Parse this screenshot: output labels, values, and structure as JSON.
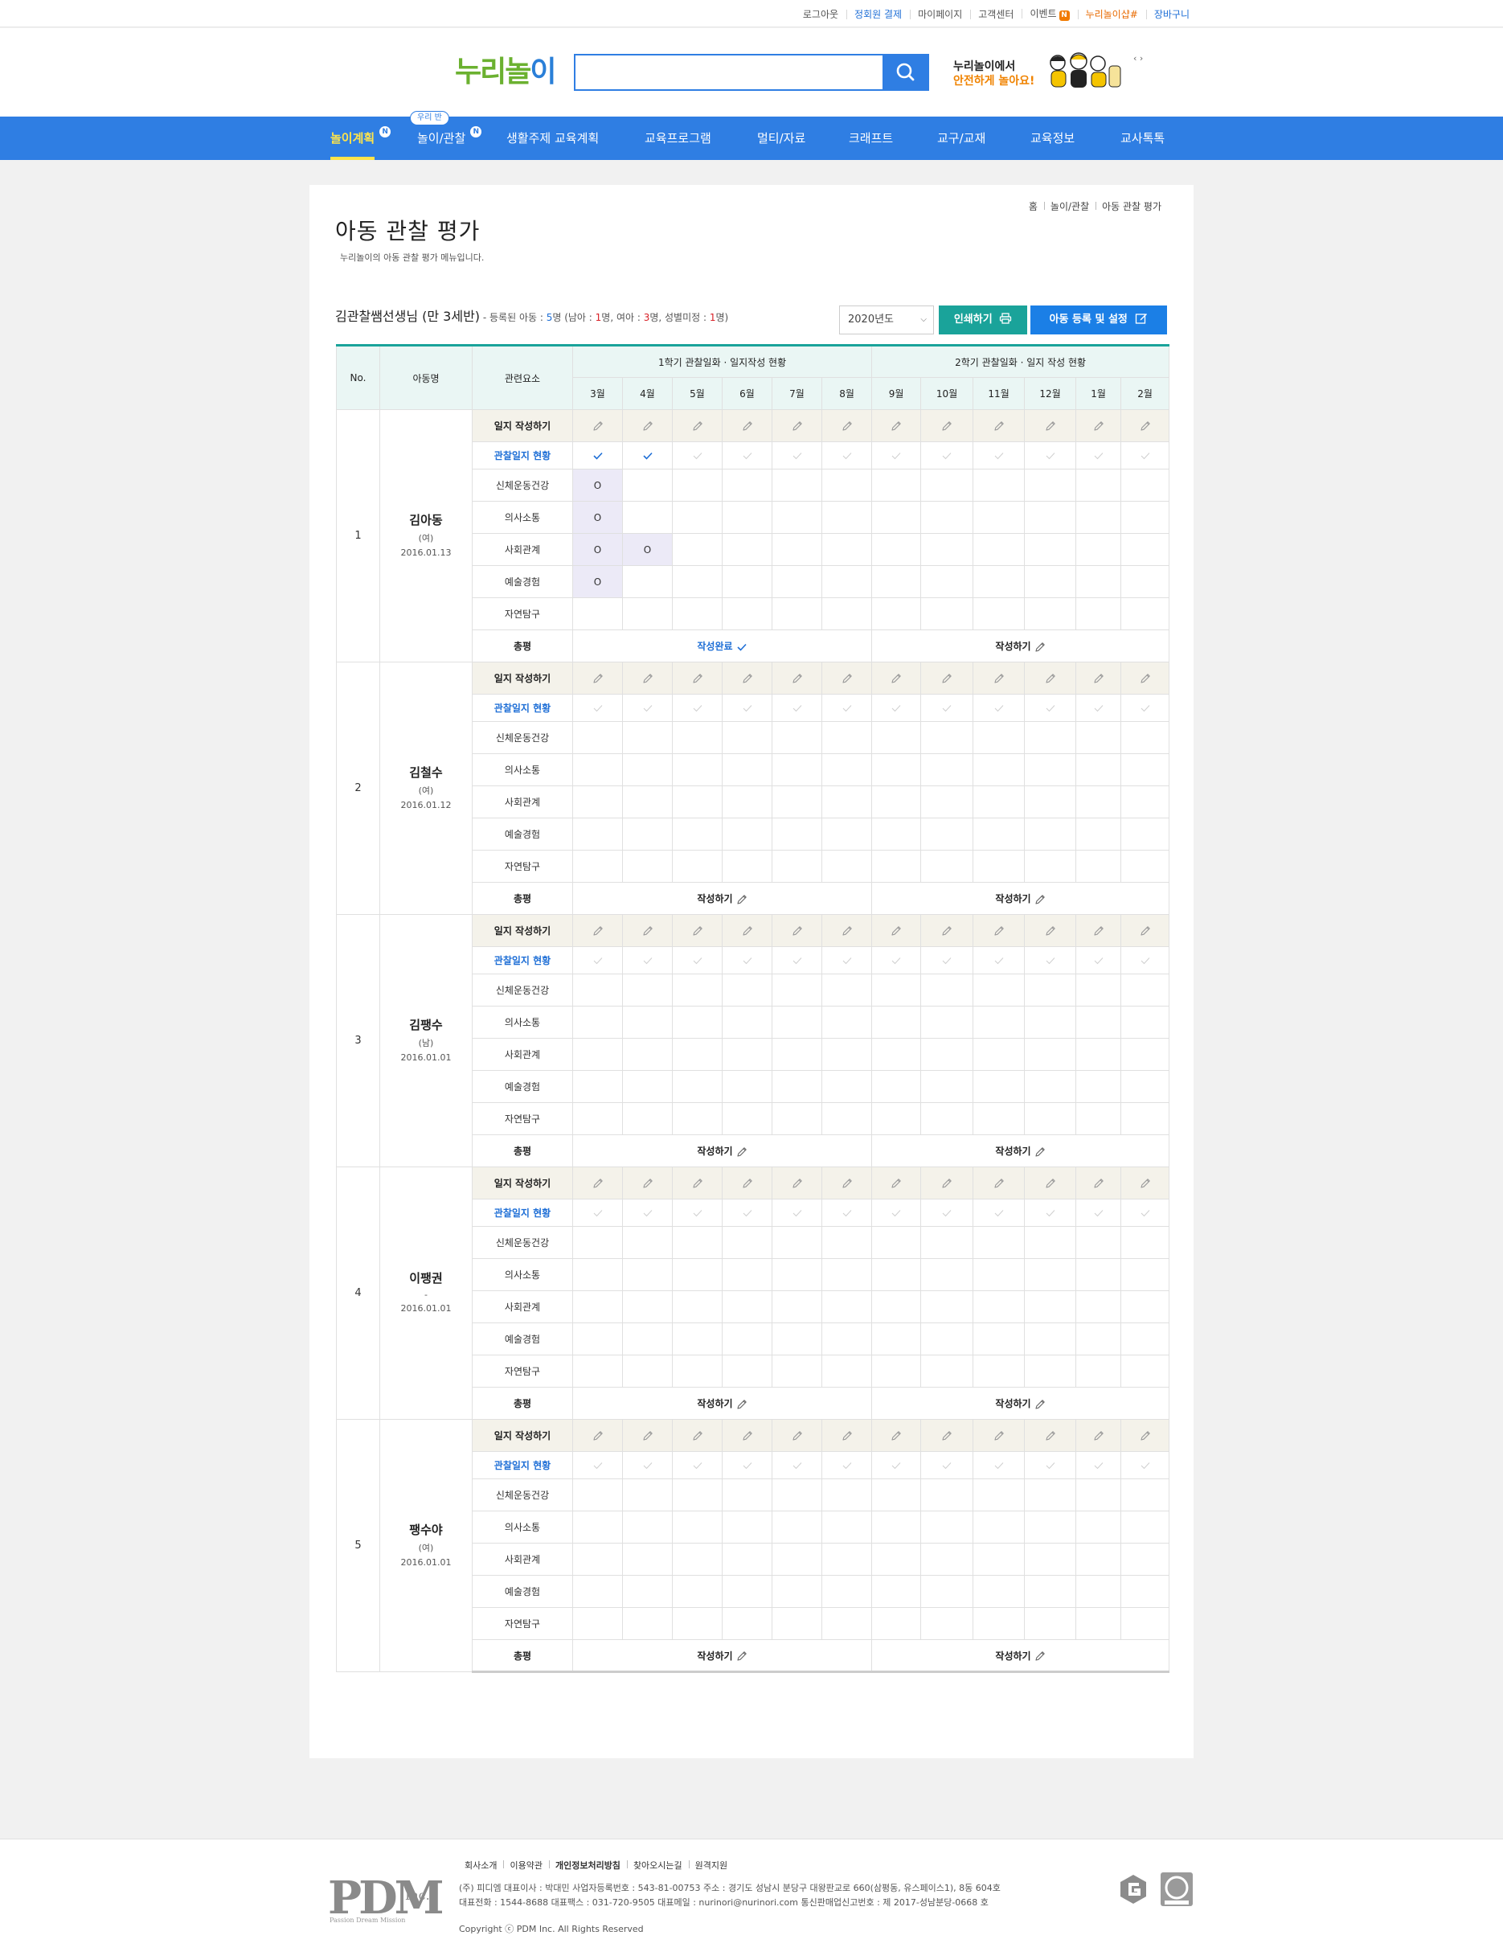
{
  "util": {
    "logout": "로그아웃",
    "payment": "정회원 결제",
    "mypage": "마이페이지",
    "support": "고객센터",
    "event": "이벤트",
    "event_badge": "N",
    "shop": "누리놀이샵",
    "cart": "장바구니"
  },
  "header": {
    "logo_a": "누리",
    "logo_b": "놀",
    "logo_c": "이",
    "promo_line1": "누리놀이에서",
    "promo_line2": "안전하게 놀아요!"
  },
  "nav": {
    "items": [
      "놀이계획",
      "놀이/관찰",
      "생활주제 교육계획",
      "교육프로그램",
      "멀티/자료",
      "크래프트",
      "교구/교재",
      "교육정보",
      "교사톡톡"
    ],
    "bubble": "우리 반",
    "badge": "N"
  },
  "breadcrumb": [
    "홈",
    "놀이/관찰",
    "아동 관찰 평가"
  ],
  "page": {
    "title": "아동 관찰 평가",
    "desc": "누리놀이의 아동 관찰 평가 메뉴입니다."
  },
  "class_info": {
    "teacher": "김관찰쌤선생님 (만 3세반)",
    "p1": " - 등록된 아동 : ",
    "total": "5",
    "p2": "명 (남아 : ",
    "boys": "1",
    "p3": "명, 여아 : ",
    "girls": "3",
    "p4": "명, 성별미정 : ",
    "unknown": "1",
    "p5": "명)"
  },
  "controls": {
    "year": "2020년도",
    "print": "인쇄하기",
    "register": "아동 등록 및 설정"
  },
  "table": {
    "headers": {
      "no": "No.",
      "child": "아동명",
      "factor": "관련요소",
      "sem1": "1학기 관찰일화 · 일지작성 현황",
      "sem2": "2학기 관찰일화 · 일지 작성 현황"
    },
    "months": [
      "3월",
      "4월",
      "5월",
      "6월",
      "7월",
      "8월",
      "9월",
      "10월",
      "11월",
      "12월",
      "1월",
      "2월"
    ],
    "row_labels": {
      "write": "일지 작성하기",
      "status": "관찰일지 현황",
      "areas": [
        "신체운동건강",
        "의사소통",
        "사회관계",
        "예술경험",
        "자연탐구"
      ],
      "total": "총평"
    },
    "write_label": "작성하기",
    "done_label": "작성완료",
    "mark": "O",
    "children": [
      {
        "no": "1",
        "name": "김아동",
        "gender": "(여)",
        "birth": "2016.01.13",
        "checks": [
          1,
          1,
          0,
          0,
          0,
          0,
          0,
          0,
          0,
          0,
          0,
          0
        ],
        "marks": [
          [
            1,
            0,
            0,
            0,
            0,
            0,
            0,
            0,
            0,
            0,
            0,
            0
          ],
          [
            1,
            0,
            0,
            0,
            0,
            0,
            0,
            0,
            0,
            0,
            0,
            0
          ],
          [
            1,
            1,
            0,
            0,
            0,
            0,
            0,
            0,
            0,
            0,
            0,
            0
          ],
          [
            1,
            0,
            0,
            0,
            0,
            0,
            0,
            0,
            0,
            0,
            0,
            0
          ],
          [
            0,
            0,
            0,
            0,
            0,
            0,
            0,
            0,
            0,
            0,
            0,
            0
          ]
        ],
        "sem1_done": true,
        "sem2_done": false
      },
      {
        "no": "2",
        "name": "김철수",
        "gender": "(여)",
        "birth": "2016.01.12",
        "checks": [
          0,
          0,
          0,
          0,
          0,
          0,
          0,
          0,
          0,
          0,
          0,
          0
        ],
        "marks": [
          [
            0,
            0,
            0,
            0,
            0,
            0,
            0,
            0,
            0,
            0,
            0,
            0
          ],
          [
            0,
            0,
            0,
            0,
            0,
            0,
            0,
            0,
            0,
            0,
            0,
            0
          ],
          [
            0,
            0,
            0,
            0,
            0,
            0,
            0,
            0,
            0,
            0,
            0,
            0
          ],
          [
            0,
            0,
            0,
            0,
            0,
            0,
            0,
            0,
            0,
            0,
            0,
            0
          ],
          [
            0,
            0,
            0,
            0,
            0,
            0,
            0,
            0,
            0,
            0,
            0,
            0
          ]
        ],
        "sem1_done": false,
        "sem2_done": false
      },
      {
        "no": "3",
        "name": "김팽수",
        "gender": "(남)",
        "birth": "2016.01.01",
        "checks": [
          0,
          0,
          0,
          0,
          0,
          0,
          0,
          0,
          0,
          0,
          0,
          0
        ],
        "marks": [
          [
            0,
            0,
            0,
            0,
            0,
            0,
            0,
            0,
            0,
            0,
            0,
            0
          ],
          [
            0,
            0,
            0,
            0,
            0,
            0,
            0,
            0,
            0,
            0,
            0,
            0
          ],
          [
            0,
            0,
            0,
            0,
            0,
            0,
            0,
            0,
            0,
            0,
            0,
            0
          ],
          [
            0,
            0,
            0,
            0,
            0,
            0,
            0,
            0,
            0,
            0,
            0,
            0
          ],
          [
            0,
            0,
            0,
            0,
            0,
            0,
            0,
            0,
            0,
            0,
            0,
            0
          ]
        ],
        "sem1_done": false,
        "sem2_done": false
      },
      {
        "no": "4",
        "name": "이팽권",
        "gender": "-",
        "birth": "2016.01.01",
        "checks": [
          0,
          0,
          0,
          0,
          0,
          0,
          0,
          0,
          0,
          0,
          0,
          0
        ],
        "marks": [
          [
            0,
            0,
            0,
            0,
            0,
            0,
            0,
            0,
            0,
            0,
            0,
            0
          ],
          [
            0,
            0,
            0,
            0,
            0,
            0,
            0,
            0,
            0,
            0,
            0,
            0
          ],
          [
            0,
            0,
            0,
            0,
            0,
            0,
            0,
            0,
            0,
            0,
            0,
            0
          ],
          [
            0,
            0,
            0,
            0,
            0,
            0,
            0,
            0,
            0,
            0,
            0,
            0
          ],
          [
            0,
            0,
            0,
            0,
            0,
            0,
            0,
            0,
            0,
            0,
            0,
            0
          ]
        ],
        "sem1_done": false,
        "sem2_done": false
      },
      {
        "no": "5",
        "name": "팽수야",
        "gender": "(여)",
        "birth": "2016.01.01",
        "checks": [
          0,
          0,
          0,
          0,
          0,
          0,
          0,
          0,
          0,
          0,
          0,
          0
        ],
        "marks": [
          [
            0,
            0,
            0,
            0,
            0,
            0,
            0,
            0,
            0,
            0,
            0,
            0
          ],
          [
            0,
            0,
            0,
            0,
            0,
            0,
            0,
            0,
            0,
            0,
            0,
            0
          ],
          [
            0,
            0,
            0,
            0,
            0,
            0,
            0,
            0,
            0,
            0,
            0,
            0
          ],
          [
            0,
            0,
            0,
            0,
            0,
            0,
            0,
            0,
            0,
            0,
            0,
            0
          ],
          [
            0,
            0,
            0,
            0,
            0,
            0,
            0,
            0,
            0,
            0,
            0,
            0
          ]
        ],
        "sem1_done": false,
        "sem2_done": false
      }
    ]
  },
  "footer": {
    "links": [
      "회사소개",
      "이용약관",
      "개인정보처리방침",
      "찾아오시는길",
      "원격지원"
    ],
    "addr1": "(주) 피디엠 대표이사 : 박대민 사업자등록번호 : 543-81-00753 주소 : 경기도 성남시 분당구 대왕판교로 660(삼평동, 유스페이스1), 8동 604호",
    "addr2": "대표전화 : 1544-8688 대표팩스 : 031-720-9505 대표메일 : nurinori@nurinori.com 통신판매업신고번호 : 제 2017-성남분당-0668 호",
    "copyright": "Copyright ⓒ PDM Inc. All Rights Reserved",
    "logo": "PDM",
    "logo_inc": "Inc.",
    "logo_tag": "Passion Dream Mission"
  },
  "colors": {
    "primary_blue": "#2f7ee3",
    "teal": "#1aa39a",
    "nav_active": "#ffe44a",
    "logo_green": "#6bb130",
    "promo_orange": "#f08300"
  }
}
